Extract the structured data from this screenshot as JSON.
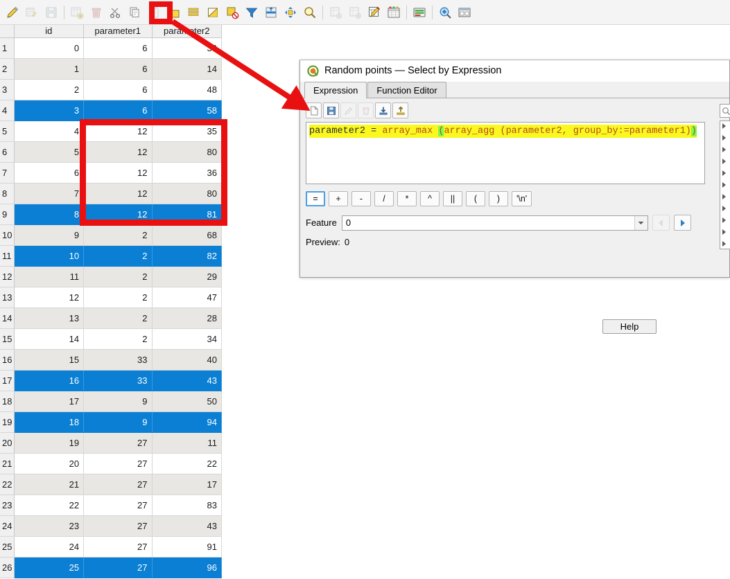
{
  "toolbar": {
    "buttons": [
      {
        "name": "toggle-editing-icon",
        "label": "Toggle editing mode",
        "enabled": true
      },
      {
        "name": "save-edits-icon",
        "label": "Save edits",
        "enabled": false
      },
      {
        "name": "reload-table-icon",
        "label": "Reload table",
        "enabled": false
      },
      {
        "name": "add-feature-icon",
        "label": "Add feature",
        "enabled": false
      },
      {
        "name": "delete-selected-icon",
        "label": "Delete selected features",
        "enabled": false
      },
      {
        "name": "cut-features-icon",
        "label": "Cut features",
        "enabled": false
      },
      {
        "name": "copy-features-icon",
        "label": "Copy features",
        "enabled": false
      },
      {
        "name": "paste-features-icon",
        "label": "Paste features",
        "enabled": false
      },
      {
        "name": "select-by-expression-icon",
        "label": "Select features using an expression",
        "enabled": true,
        "highlighted": true
      },
      {
        "name": "select-all-icon",
        "label": "Select all",
        "enabled": true
      },
      {
        "name": "invert-selection-icon",
        "label": "Invert selection",
        "enabled": true
      },
      {
        "name": "deselect-all-icon",
        "label": "Deselect all",
        "enabled": true
      },
      {
        "name": "filter-icon",
        "label": "Filter features",
        "enabled": true
      },
      {
        "name": "move-selection-to-top-icon",
        "label": "Move selection to top",
        "enabled": true
      },
      {
        "name": "pan-to-selected-icon",
        "label": "Pan map to selected rows",
        "enabled": true
      },
      {
        "name": "zoom-to-selected-icon",
        "label": "Zoom map to selected rows",
        "enabled": true
      },
      {
        "name": "new-field-icon",
        "label": "New field",
        "enabled": false
      },
      {
        "name": "delete-field-icon",
        "label": "Delete field",
        "enabled": false
      },
      {
        "name": "field-calculator-icon",
        "label": "Open field calculator",
        "enabled": true
      },
      {
        "name": "conditional-formatting-icon",
        "label": "Conditional formatting",
        "enabled": true
      },
      {
        "name": "actions-icon",
        "label": "Actions",
        "enabled": true
      },
      {
        "name": "form-view-icon",
        "label": "Switch to form view",
        "enabled": true
      },
      {
        "name": "dock-undock-icon",
        "label": "Dock attribute table",
        "enabled": true
      }
    ]
  },
  "table": {
    "columns": [
      "id",
      "parameter1",
      "parameter2"
    ],
    "rows": [
      {
        "n": "1",
        "id": "0",
        "p1": "6",
        "p2": "39",
        "selected": false,
        "alt": false
      },
      {
        "n": "2",
        "id": "1",
        "p1": "6",
        "p2": "14",
        "selected": false,
        "alt": true
      },
      {
        "n": "3",
        "id": "2",
        "p1": "6",
        "p2": "48",
        "selected": false,
        "alt": false
      },
      {
        "n": "4",
        "id": "3",
        "p1": "6",
        "p2": "58",
        "selected": true,
        "alt": true
      },
      {
        "n": "5",
        "id": "4",
        "p1": "12",
        "p2": "35",
        "selected": false,
        "alt": false
      },
      {
        "n": "6",
        "id": "5",
        "p1": "12",
        "p2": "80",
        "selected": false,
        "alt": true
      },
      {
        "n": "7",
        "id": "6",
        "p1": "12",
        "p2": "36",
        "selected": false,
        "alt": false
      },
      {
        "n": "8",
        "id": "7",
        "p1": "12",
        "p2": "80",
        "selected": false,
        "alt": true
      },
      {
        "n": "9",
        "id": "8",
        "p1": "12",
        "p2": "81",
        "selected": true,
        "alt": false
      },
      {
        "n": "10",
        "id": "9",
        "p1": "2",
        "p2": "68",
        "selected": false,
        "alt": true
      },
      {
        "n": "11",
        "id": "10",
        "p1": "2",
        "p2": "82",
        "selected": true,
        "alt": false
      },
      {
        "n": "12",
        "id": "11",
        "p1": "2",
        "p2": "29",
        "selected": false,
        "alt": true
      },
      {
        "n": "13",
        "id": "12",
        "p1": "2",
        "p2": "47",
        "selected": false,
        "alt": false
      },
      {
        "n": "14",
        "id": "13",
        "p1": "2",
        "p2": "28",
        "selected": false,
        "alt": true
      },
      {
        "n": "15",
        "id": "14",
        "p1": "2",
        "p2": "34",
        "selected": false,
        "alt": false
      },
      {
        "n": "16",
        "id": "15",
        "p1": "33",
        "p2": "40",
        "selected": false,
        "alt": true
      },
      {
        "n": "17",
        "id": "16",
        "p1": "33",
        "p2": "43",
        "selected": true,
        "alt": false
      },
      {
        "n": "18",
        "id": "17",
        "p1": "9",
        "p2": "50",
        "selected": false,
        "alt": true
      },
      {
        "n": "19",
        "id": "18",
        "p1": "9",
        "p2": "94",
        "selected": true,
        "alt": false
      },
      {
        "n": "20",
        "id": "19",
        "p1": "27",
        "p2": "11",
        "selected": false,
        "alt": true
      },
      {
        "n": "21",
        "id": "20",
        "p1": "27",
        "p2": "22",
        "selected": false,
        "alt": false
      },
      {
        "n": "22",
        "id": "21",
        "p1": "27",
        "p2": "17",
        "selected": false,
        "alt": true
      },
      {
        "n": "23",
        "id": "22",
        "p1": "27",
        "p2": "83",
        "selected": false,
        "alt": false
      },
      {
        "n": "24",
        "id": "23",
        "p1": "27",
        "p2": "43",
        "selected": false,
        "alt": true
      },
      {
        "n": "25",
        "id": "24",
        "p1": "27",
        "p2": "91",
        "selected": false,
        "alt": false
      },
      {
        "n": "26",
        "id": "25",
        "p1": "27",
        "p2": "96",
        "selected": true,
        "alt": true
      }
    ]
  },
  "dialog": {
    "title": "Random points — Select by Expression",
    "logo_icon": "qgis-logo-icon",
    "tabs": [
      {
        "label": "Expression",
        "active": true
      },
      {
        "label": "Function Editor",
        "active": false
      }
    ],
    "expr_toolbar": [
      {
        "name": "new-expression-icon",
        "label": "New",
        "enabled": true
      },
      {
        "name": "save-expression-icon",
        "label": "Save expression",
        "enabled": true
      },
      {
        "name": "edit-expression-icon",
        "label": "Edit expression",
        "enabled": false
      },
      {
        "name": "delete-expression-icon",
        "label": "Delete expression",
        "enabled": false
      },
      {
        "name": "import-expressions-icon",
        "label": "Import expressions",
        "enabled": true
      },
      {
        "name": "export-expressions-icon",
        "label": "Export expressions",
        "enabled": true
      }
    ],
    "expression": {
      "full_text": "parameter2 = array_max (array_agg (parameter2, group_by:=parameter1))",
      "seg_field1": "parameter2 ",
      "seg_eq": "= ",
      "seg_func1": "array_max ",
      "seg_paren_open": "(",
      "seg_func2": "array_agg ",
      "seg_inner": "(parameter2, group_by:=parameter1)",
      "seg_paren_close": ")"
    },
    "operators": [
      "=",
      "+",
      "-",
      "/",
      "*",
      "^",
      "||",
      "(",
      ")",
      "'\\n'"
    ],
    "operator_selected": "=",
    "feature_label": "Feature",
    "feature_value": "0",
    "preview_label": "Preview:",
    "preview_value": "0",
    "help_label": "Help",
    "nav": {
      "prev_icon": "triangle-left-icon",
      "next_icon": "triangle-right-icon",
      "dropdown_icon": "chevron-down-icon"
    },
    "function_pane": {
      "search_icon": "search-icon",
      "expander_icon": "triangle-right-icon",
      "expander_count": 11
    }
  },
  "annotations": {
    "highlight_color": "#e81010",
    "rect_label": "parameter1-parameter2-group-highlight",
    "toolbar_box_label": "select-by-expression-highlight",
    "arrow_label": "toolbar-to-dialog-arrow"
  },
  "colors": {
    "selection_blue": "#0a7fd4",
    "row_alt": "#e9e7e3",
    "expression_highlight": "#fbf81f",
    "paren_match": "#7dfb4a",
    "annotation_red": "#e81010"
  }
}
